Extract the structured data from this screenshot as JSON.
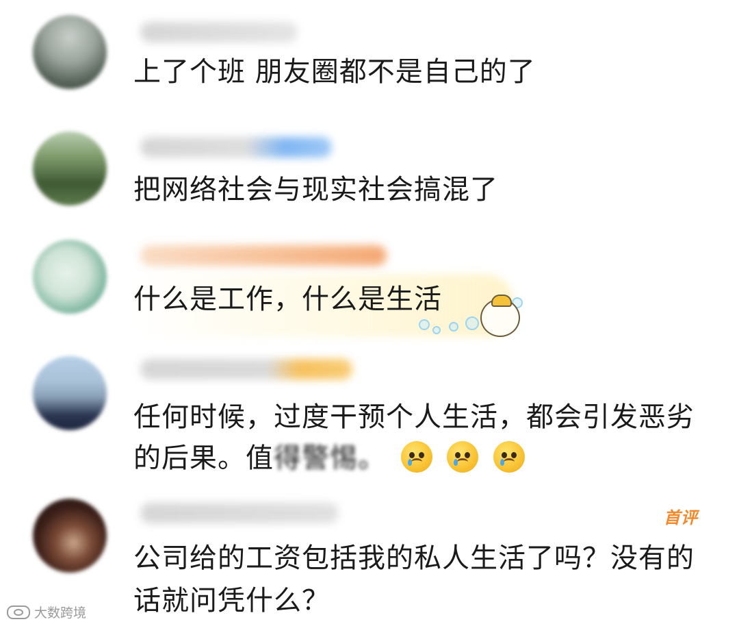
{
  "comments": [
    {
      "text": "上了个班  朋友圈都不是自己的了",
      "colors": {
        "avatar": [
          "#6f7a70",
          "#c9cfca",
          "#2e3a2f"
        ],
        "username": [
          "#c8c8c8",
          "#dcdcdc"
        ]
      }
    },
    {
      "text": "把网络社会与现实社会搞混了",
      "colors": {
        "avatar": [
          "#3f5a34",
          "#7d9a6a",
          "#a9c0a0"
        ],
        "username": [
          "#c8c8c8",
          "#6aa9f0"
        ]
      }
    },
    {
      "text": "什么是工作，什么是生活",
      "colors": {
        "avatar": [
          "#cfe3d6",
          "#7fb7a1",
          "#3d7ea8"
        ],
        "username": [
          "#f6c39c",
          "#f39a5d"
        ]
      }
    },
    {
      "text_line1": "任何时候，过度干预个人生活，都会引发恶劣",
      "text_line2_visible": "的后果。值",
      "text_line2_blurred": "得警惕",
      "text_line2_tail": "。",
      "emoji_count": 3,
      "emoji_name": "crying-face-emoji",
      "colors": {
        "avatar": [
          "#b8d0e8",
          "#2b3550",
          "#8aa1b7"
        ],
        "username": [
          "#c8c8c8",
          "#f5b642"
        ]
      }
    },
    {
      "badge": "首评",
      "text_line1": "公司给的工资包括我的私人生活了吗？没有的",
      "text_line2": "话就问凭什么？",
      "colors": {
        "avatar": [
          "#1a1412",
          "#5a2a1e",
          "#c8a48a"
        ],
        "username": [
          "#c8c8c8",
          "#d6d6d6"
        ]
      }
    }
  ],
  "watermark": {
    "text": "大数跨境",
    "icon": "weibo-logo-icon"
  },
  "sticker": {
    "icon": "mascot-bubble-sticker-icon"
  }
}
